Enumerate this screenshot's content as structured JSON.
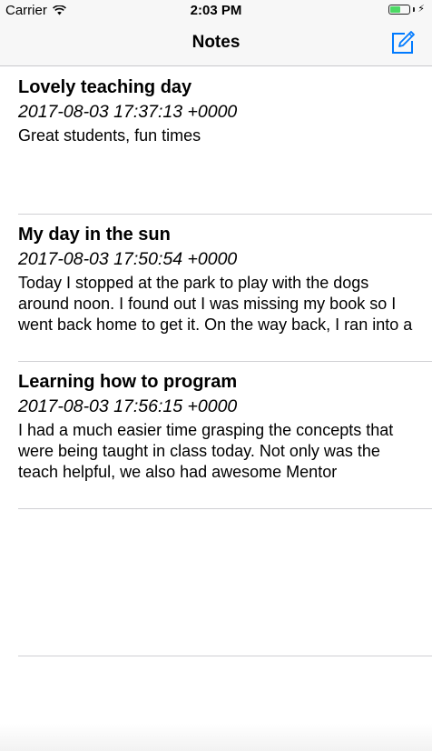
{
  "status_bar": {
    "carrier": "Carrier",
    "time": "2:03 PM",
    "battery_level": 0.55,
    "battery_color": "#4cd964"
  },
  "nav_bar": {
    "title": "Notes",
    "compose_icon": "compose-icon",
    "accent_color": "#007aff"
  },
  "notes": [
    {
      "title": "Lovely teaching day",
      "date": "2017-08-03 17:37:13 +0000",
      "body": "Great students, fun times"
    },
    {
      "title": "My day in the sun",
      "date": "2017-08-03 17:50:54 +0000",
      "body": "Today I stopped at the park to play with the dogs around noon.  I found out I was missing my book so I went back home to get it.  On the way back, I ran into a few friends I hadn't seen in a very very long"
    },
    {
      "title": "Learning how to program",
      "date": "2017-08-03 17:56:15 +0000",
      "body": "I had a much easier time grasping the concepts that were being taught in class today. Not only was the teach helpful, we also had awesome Mentor Assistants."
    }
  ]
}
